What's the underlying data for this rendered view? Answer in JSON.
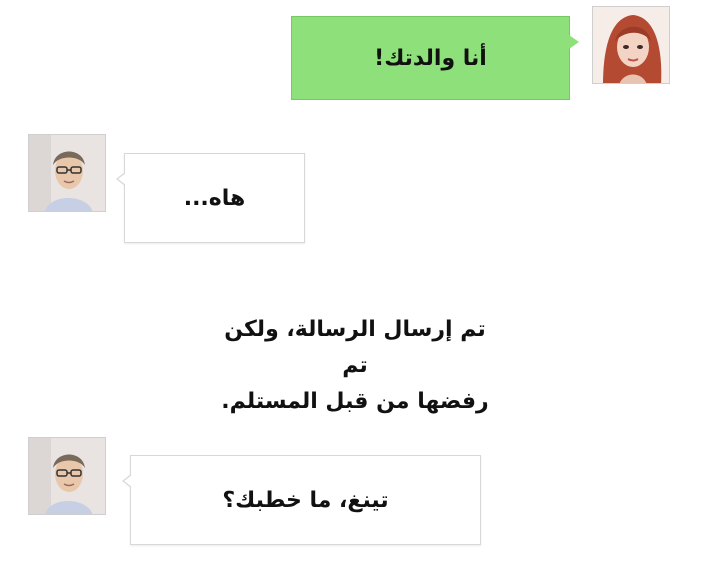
{
  "messages": [
    {
      "sender": "woman",
      "side": "right",
      "text": "أنا والدتك!"
    },
    {
      "sender": "father",
      "side": "left",
      "text": "هاه..."
    },
    {
      "sender": "father",
      "side": "left",
      "text": "تينغ، ما خطبك؟"
    }
  ],
  "system": {
    "line1": "تم إرسال الرسالة، ولكن تم",
    "line2": "رفضها من قبل المستلم."
  },
  "colors": {
    "sent_bubble": "#8ee07a",
    "received_bubble": "#ffffff",
    "border": "#d8d8d8"
  },
  "icons": {
    "woman_avatar": "woman-avatar-icon",
    "father_avatar": "man-with-glasses-avatar-icon"
  }
}
